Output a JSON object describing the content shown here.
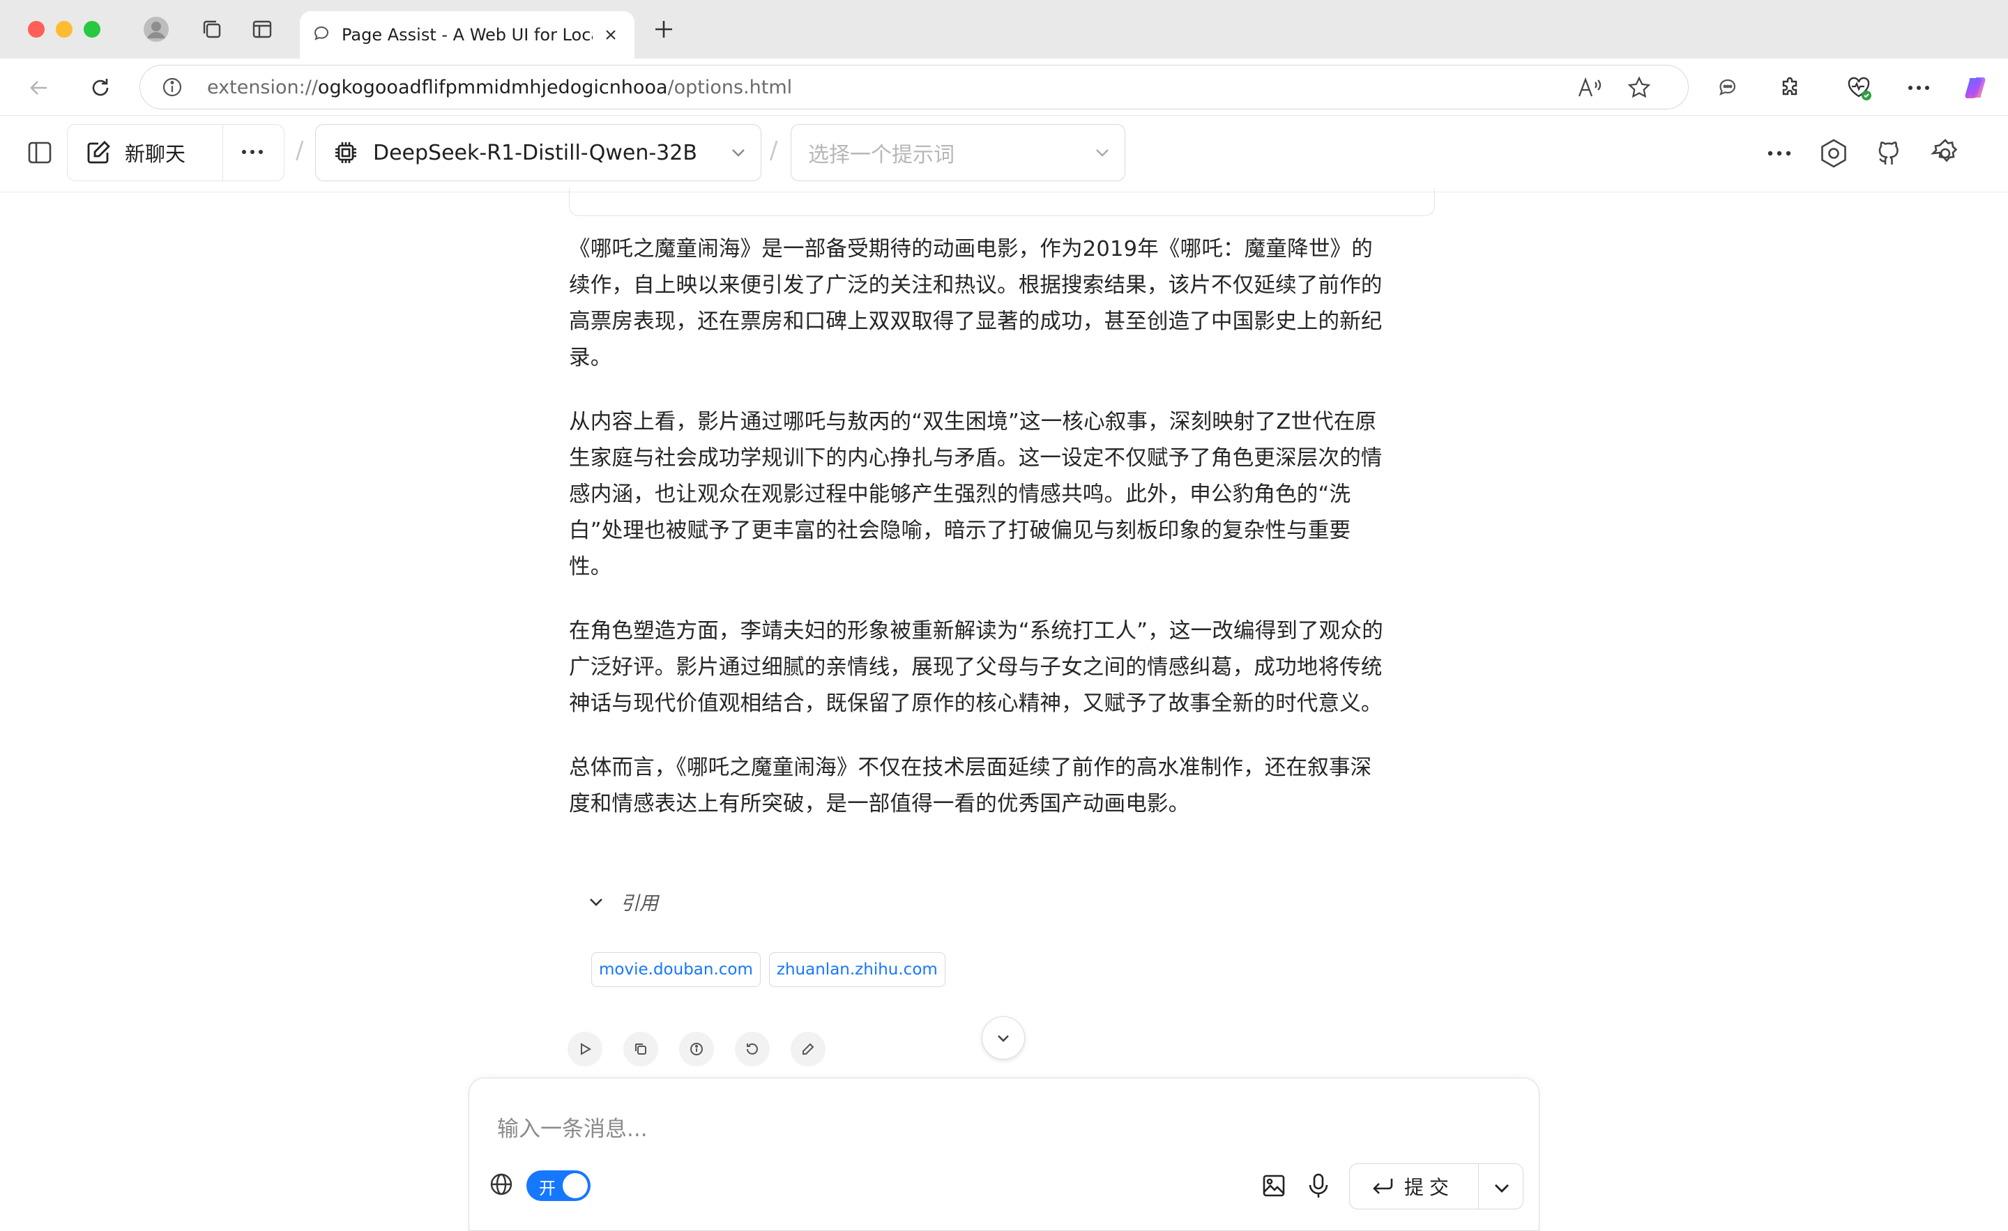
{
  "browser": {
    "tab": {
      "title": "Page Assist - A Web UI for Local AI Models"
    },
    "url": {
      "scheme": "extension://",
      "host": "ogkogooadflifpmmidmhjedogicnhooa",
      "path": "/options.html"
    }
  },
  "header": {
    "new_chat_label": "新聊天",
    "model_select": {
      "value": "DeepSeek-R1-Distill-Qwen-32B"
    },
    "prompt_select": {
      "placeholder": "选择一个提示词"
    },
    "separator": "/"
  },
  "answer": {
    "paragraphs": [
      "《哪吒之魔童闹海》是一部备受期待的动画电影，作为2019年《哪吒：魔童降世》的续作，自上映以来便引发了广泛的关注和热议。根据搜索结果，该片不仅延续了前作的高票房表现，还在票房和口碑上双双取得了显著的成功，甚至创造了中国影史上的新纪录。",
      "从内容上看，影片通过哪吒与敖丙的“双生困境”这一核心叙事，深刻映射了Z世代在原生家庭与社会成功学规训下的内心挣扎与矛盾。这一设定不仅赋予了角色更深层次的情感内涵，也让观众在观影过程中能够产生强烈的情感共鸣。此外，申公豹角色的“洗白”处理也被赋予了更丰富的社会隐喻，暗示了打破偏见与刻板印象的复杂性与重要性。",
      "在角色塑造方面，李靖夫妇的形象被重新解读为“系统打工人”，这一改编得到了观众的广泛好评。影片通过细腻的亲情线，展现了父母与子女之间的情感纠葛，成功地将传统神话与现代价值观相结合，既保留了原作的核心精神，又赋予了故事全新的时代意义。",
      "总体而言，《哪吒之魔童闹海》不仅在技术层面延续了前作的高水准制作，还在叙事深度和情感表达上有所突破，是一部值得一看的优秀国产动画电影。"
    ],
    "citations_label": "引用",
    "citations": [
      "movie.douban.com",
      "zhuanlan.zhihu.com"
    ]
  },
  "composer": {
    "placeholder": "输入一条消息...",
    "web_toggle": {
      "label": "开",
      "on": true
    },
    "submit_label": "提交"
  },
  "colors": {
    "accent": "#1677ff",
    "link": "#1677ff"
  }
}
